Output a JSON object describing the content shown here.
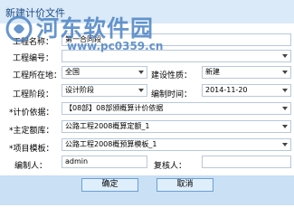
{
  "window": {
    "title": "新建计价文件"
  },
  "watermark": {
    "name": "河东软件园",
    "url": "www.pc0359.cn",
    "logo_icon": "hedong-logo-icon"
  },
  "form": {
    "project_name": {
      "label": "工程名称：",
      "value": "第一合同段"
    },
    "project_code": {
      "label": "工程编号：",
      "value": ""
    },
    "location": {
      "label": "工程所在地：",
      "value": "全国"
    },
    "nature": {
      "label": "建设性质：",
      "value": "新建"
    },
    "stage": {
      "label": "工程阶段：",
      "value": "设计阶段"
    },
    "date": {
      "label": "编制时间：",
      "value": "2014-11-20"
    },
    "basis": {
      "label": "*计价依据：",
      "value": "【08部】08部颁概算计价依据"
    },
    "quota": {
      "label": "*主定额库：",
      "value": "公路工程2008概算定额_1"
    },
    "template": {
      "label": "*项目模板：",
      "value": "公路工程2008概预算模板_1"
    },
    "author": {
      "label": "编制人：",
      "value": "admin"
    },
    "reviewer": {
      "label": "复核人：",
      "value": ""
    }
  },
  "buttons": {
    "ok": "确定",
    "cancel": "取消"
  },
  "colors": {
    "title_bar": "#dbeaf8",
    "watermark": "#4c83c4",
    "field_border": "#b8c8dc",
    "button_bar": "#c9e0f5",
    "button_border": "#6d9fd3"
  }
}
